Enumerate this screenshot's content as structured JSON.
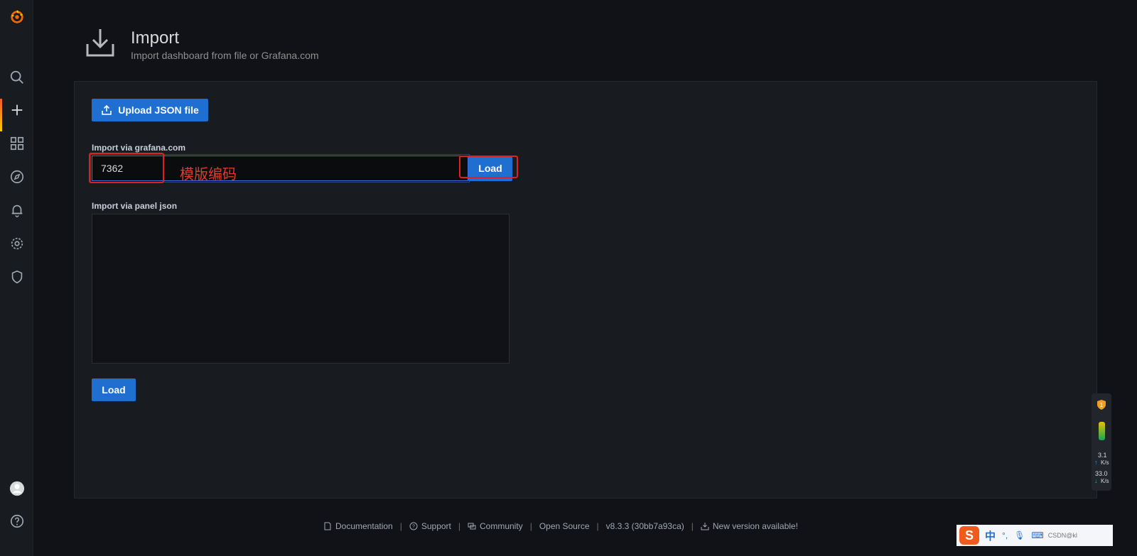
{
  "sidebar": {
    "items": [
      {
        "name": "grafana-logo-icon"
      },
      {
        "name": "search-icon"
      },
      {
        "name": "plus-icon"
      },
      {
        "name": "dashboards-icon"
      },
      {
        "name": "explore-icon"
      },
      {
        "name": "alerting-bell-icon"
      },
      {
        "name": "configuration-gear-icon"
      },
      {
        "name": "server-admin-shield-icon"
      },
      {
        "name": "user-avatar-icon"
      },
      {
        "name": "help-icon"
      }
    ]
  },
  "header": {
    "title": "Import",
    "subtitle": "Import dashboard from file or Grafana.com"
  },
  "import_panel": {
    "upload_label": "Upload JSON file",
    "grafana_com_label": "Import via grafana.com",
    "grafana_com_value": "7362",
    "load_label": "Load",
    "panel_json_label": "Import via panel json",
    "panel_json_value": "",
    "load2_label": "Load"
  },
  "annotation": {
    "text": "模版编码",
    "color": "#e02020"
  },
  "footer": {
    "documentation": "Documentation",
    "support": "Support",
    "community": "Community",
    "open_source": "Open Source",
    "version": "v8.3.3 (30bb7a93ca)",
    "new_version": "New version available!"
  },
  "net_widget": {
    "badge": "1",
    "up_value": "3.1",
    "up_unit": "K/s",
    "down_value": "33.0",
    "down_unit": "K/s"
  },
  "ime": {
    "logo": "S",
    "mode": "中",
    "punct": "°,",
    "watermark": "CSDN@kl"
  },
  "colors": {
    "accent_blue": "#1f6fd1",
    "background": "#111217",
    "panel": "#181b1f"
  }
}
